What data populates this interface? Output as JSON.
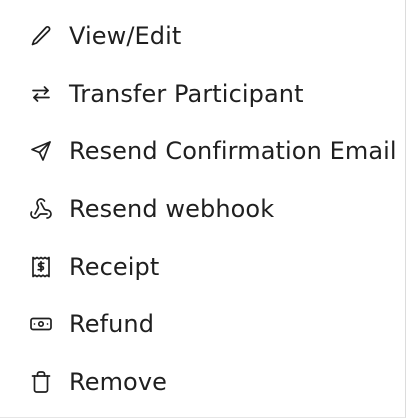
{
  "menu": {
    "items": [
      {
        "label": "View/Edit",
        "icon": "pencil-icon"
      },
      {
        "label": "Transfer Participant",
        "icon": "arrows-left-right-icon"
      },
      {
        "label": "Resend Confirmation Email",
        "icon": "send-icon"
      },
      {
        "label": "Resend webhook",
        "icon": "webhook-icon"
      },
      {
        "label": "Receipt",
        "icon": "receipt-icon"
      },
      {
        "label": "Refund",
        "icon": "banknote-icon"
      },
      {
        "label": "Remove",
        "icon": "trash-icon"
      }
    ]
  }
}
